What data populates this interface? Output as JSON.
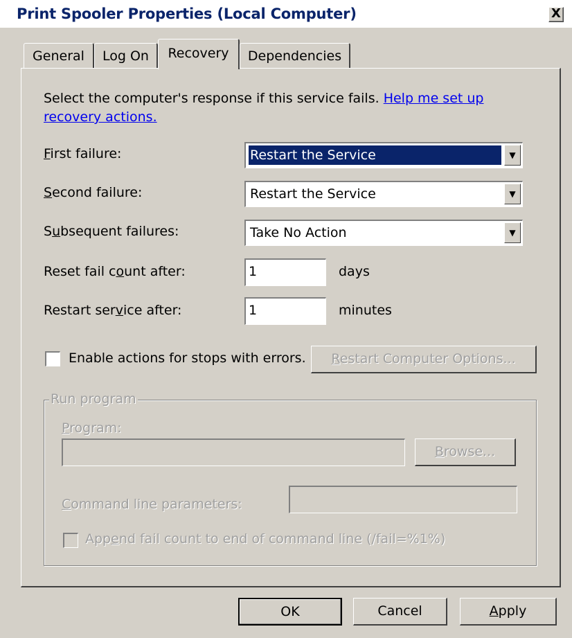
{
  "window": {
    "title": "Print Spooler Properties (Local Computer)",
    "close_glyph": "X"
  },
  "tabs": [
    {
      "label": "General",
      "active": false
    },
    {
      "label": "Log On",
      "active": false
    },
    {
      "label": "Recovery",
      "active": true
    },
    {
      "label": "Dependencies",
      "active": false
    }
  ],
  "recovery": {
    "intro_text": "Select the computer's response if this service fails. ",
    "help_link": "Help me set up recovery actions.",
    "first_failure": {
      "label_accel": "F",
      "label_rest": "irst failure:",
      "value": "Restart the Service"
    },
    "second_failure": {
      "label_accel": "S",
      "label_rest": "econd failure:",
      "value": "Restart the Service"
    },
    "subsequent_failures": {
      "label_pre": "S",
      "label_accel": "u",
      "label_rest": "bsequent failures:",
      "value": "Take No Action"
    },
    "reset_fail_count": {
      "label_pre": "Reset fail c",
      "label_accel": "o",
      "label_rest": "unt after:",
      "value": "1",
      "unit": "days"
    },
    "restart_service": {
      "label_pre": "Restart ser",
      "label_accel": "v",
      "label_rest": "ice after:",
      "value": "1",
      "unit": "minutes"
    },
    "enable_actions": {
      "label": "Enable actions for stops with errors.",
      "checked": false
    },
    "restart_computer_options": {
      "accel": "R",
      "rest": "estart Computer Options..."
    }
  },
  "run_program": {
    "legend": "Run program",
    "program_label_accel": "P",
    "program_label_rest": "rogram:",
    "program_value": "",
    "browse_accel": "B",
    "browse_rest": "rowse...",
    "cmd_label_accel": "C",
    "cmd_label_rest": "ommand line parameters:",
    "cmd_value": "",
    "append_pre": "App",
    "append_accel": "e",
    "append_rest": "nd fail count to end of command line (/fail=%1%)"
  },
  "buttons": {
    "ok": "OK",
    "cancel": "Cancel",
    "apply_accel": "A",
    "apply_rest": "pply"
  }
}
